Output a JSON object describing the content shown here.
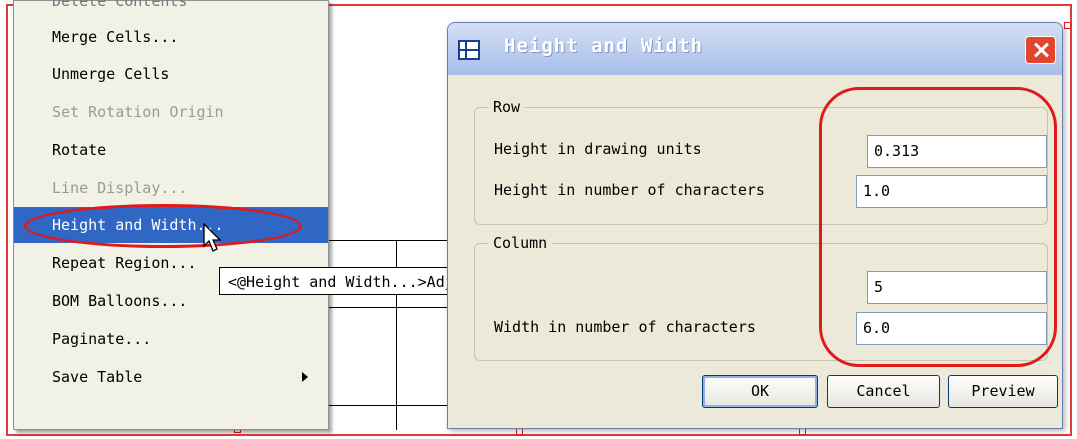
{
  "context_menu": {
    "items": [
      {
        "label": "Delete Contents",
        "disabled": false
      },
      {
        "label": "Merge Cells...",
        "disabled": false
      },
      {
        "label": "Unmerge Cells",
        "disabled": false
      },
      {
        "label": "Set Rotation Origin",
        "disabled": true
      },
      {
        "label": "Rotate",
        "disabled": false
      },
      {
        "label": "Line Display...",
        "disabled": true
      },
      {
        "label": "Height and Width...",
        "disabled": false,
        "highlighted": true
      },
      {
        "label": "Repeat Region...",
        "disabled": false
      },
      {
        "label": "BOM Balloons...",
        "disabled": false
      },
      {
        "label": "Paginate...",
        "disabled": false
      },
      {
        "label": "Save Table",
        "disabled": false,
        "has_submenu": true
      }
    ]
  },
  "tooltip": {
    "text": "<@Height and Width...>Adjust row height and column width."
  },
  "dialog": {
    "title": "Height and Width",
    "row_group": {
      "label": "Row",
      "height_drawing_units_label": "Height in drawing units",
      "height_drawing_units_value": "0.313",
      "height_characters_label": "Height in number of characters",
      "height_characters_value": "1.0"
    },
    "column_group": {
      "label": "Column",
      "width_drawing_units_value": "5",
      "width_characters_label": "Width in number of characters",
      "width_characters_value": "6.0"
    },
    "buttons": {
      "ok": "OK",
      "cancel": "Cancel",
      "preview": "Preview"
    }
  },
  "colors": {
    "highlight": "#3167c4",
    "annotation_red": "#e01a1a",
    "dialog_bg": "#ece9d8"
  }
}
